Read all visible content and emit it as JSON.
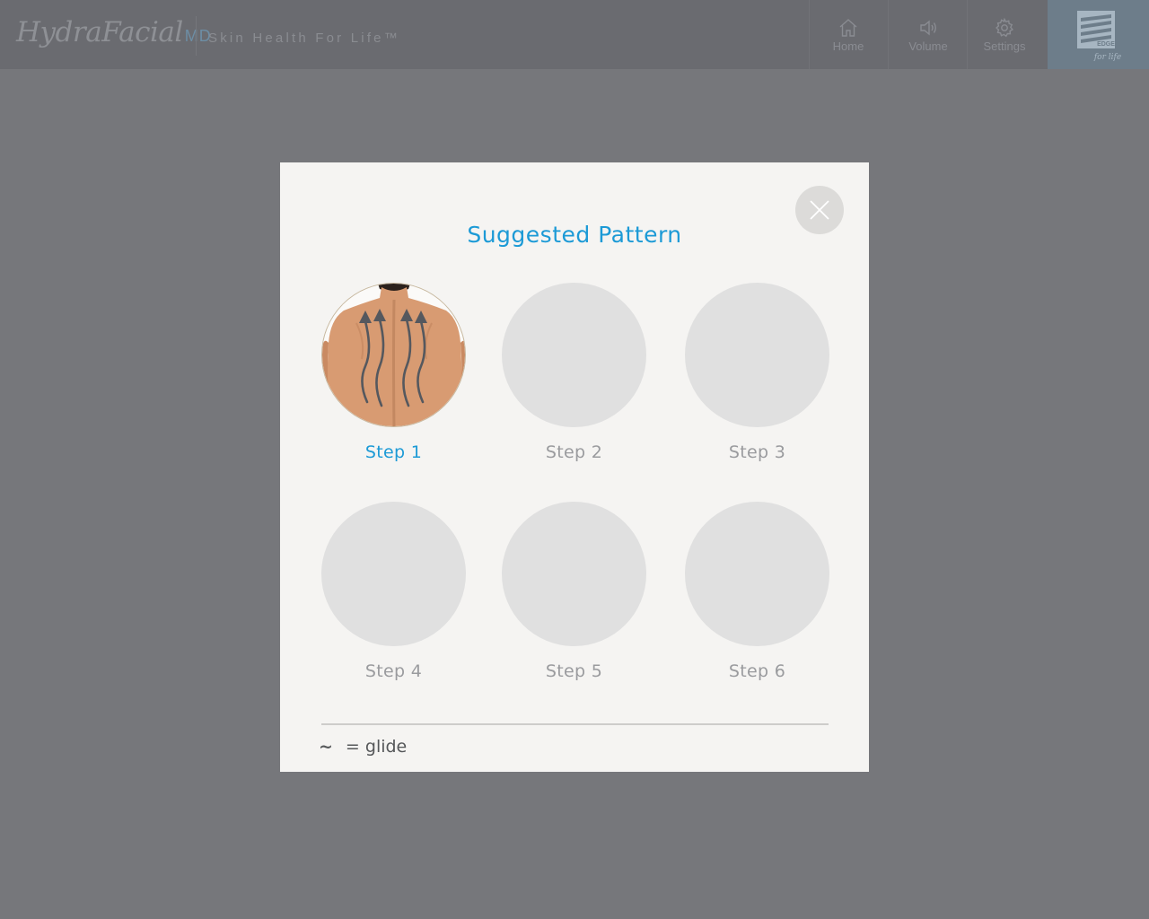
{
  "header": {
    "logo": "HydraFacial",
    "logo_suffix": "MD",
    "tagline": "Skin Health For Life™",
    "nav": [
      {
        "label": "Home",
        "icon": "home-icon"
      },
      {
        "label": "Volume",
        "icon": "speaker-icon"
      },
      {
        "label": "Settings",
        "icon": "gear-icon"
      }
    ],
    "edge_logo_text": "EDGE",
    "edge_logo_script": "for life"
  },
  "modal": {
    "title": "Suggested Pattern",
    "steps": [
      {
        "label": "Step 1",
        "active": true
      },
      {
        "label": "Step 2",
        "active": false
      },
      {
        "label": "Step 3",
        "active": false
      },
      {
        "label": "Step 4",
        "active": false
      },
      {
        "label": "Step 5",
        "active": false
      },
      {
        "label": "Step 6",
        "active": false
      }
    ],
    "legend_symbol": "~",
    "legend_text": "= glide"
  },
  "colors": {
    "accent": "#1c9ad6",
    "background": "#76777b",
    "header": "#6a6b70",
    "modal": "#f5f4f2"
  }
}
